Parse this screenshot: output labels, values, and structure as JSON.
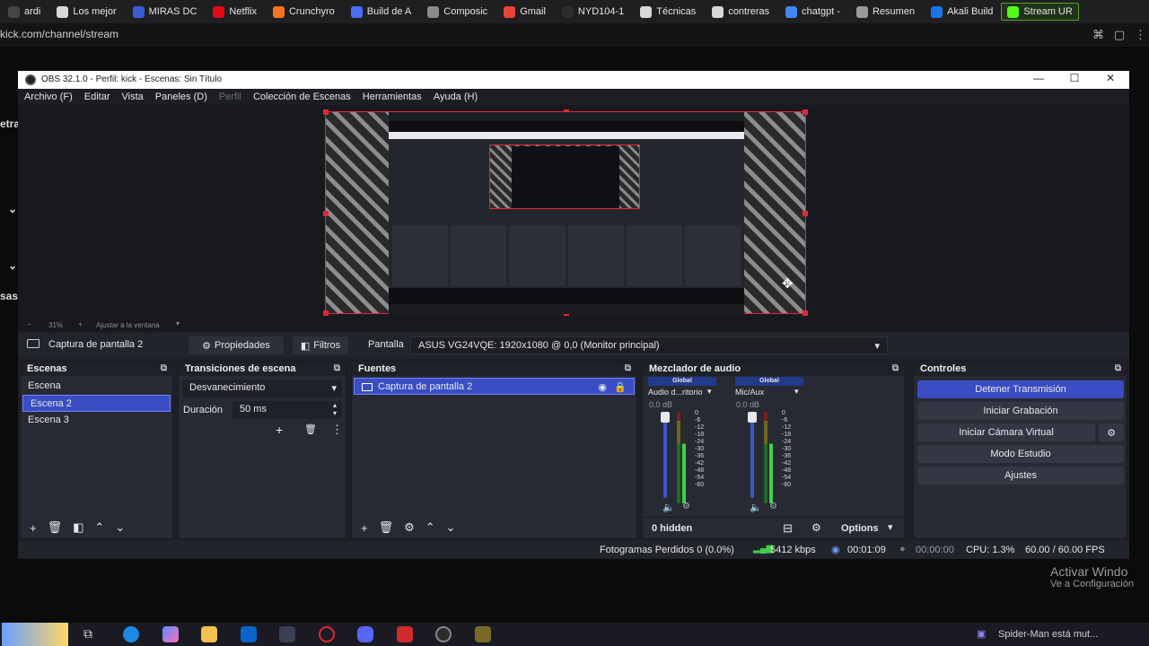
{
  "browser": {
    "bookmarks": [
      {
        "label": "ardi",
        "color": "#444444"
      },
      {
        "label": "Los mejor",
        "color": "#d8d8d8"
      },
      {
        "label": "MIRAS DC",
        "color": "#3a5bd6"
      },
      {
        "label": "Netflix",
        "color": "#e50914"
      },
      {
        "label": "Crunchyro",
        "color": "#f47521"
      },
      {
        "label": "Build de A",
        "color": "#4a6cf7"
      },
      {
        "label": "Composic",
        "color": "#8a8a8a"
      },
      {
        "label": "Gmail",
        "color": "#ea4335"
      },
      {
        "label": "NYD104-1",
        "color": "#2b2b2b"
      },
      {
        "label": "Técnicas",
        "color": "#d8d8d8"
      },
      {
        "label": "contreras",
        "color": "#d8d8d8"
      },
      {
        "label": "chatgpt -",
        "color": "#4285f4"
      },
      {
        "label": "Resumen",
        "color": "#9a9a9a"
      },
      {
        "label": "Akali Build",
        "color": "#1a73e8"
      },
      {
        "label": "Stream UR",
        "color": "#53fc18"
      }
    ],
    "url": "kick.com/channel/stream"
  },
  "page_sidebar": {
    "frag_top": "etra",
    "frag_bottom": "sas"
  },
  "obs": {
    "title": "OBS 32.1.0 - Perfil: kick - Escenas: Sin Título",
    "window_controls": {
      "minimize": "—",
      "maximize": "☐",
      "close": "✕"
    },
    "menu": [
      {
        "label": "Archivo (F)",
        "disabled": false
      },
      {
        "label": "Editar",
        "disabled": false
      },
      {
        "label": "Vista",
        "disabled": false
      },
      {
        "label": "Paneles (D)",
        "disabled": false
      },
      {
        "label": "Perfil",
        "disabled": true
      },
      {
        "label": "Colección de Escenas",
        "disabled": false
      },
      {
        "label": "Herramientas",
        "disabled": false
      },
      {
        "label": "Ayuda (H)",
        "disabled": false
      }
    ],
    "zoom": {
      "minus": "−",
      "value": "31%",
      "plus": "+",
      "fit": "Ajustar a la ventana"
    },
    "source_bar": {
      "source_name": "Captura de pantalla 2",
      "properties": "Propiedades",
      "filters": "Filtros",
      "display_label": "Pantalla",
      "display_value": "ASUS VG24VQE: 1920x1080 @ 0,0 (Monitor principal)"
    },
    "scenes": {
      "title": "Escenas",
      "items": [
        "Escena",
        "Escena 2",
        "Escena 3"
      ],
      "selected": 1
    },
    "transitions": {
      "title": "Transiciones de escena",
      "type": "Desvanecimiento",
      "duration_label": "Duración",
      "duration_value": "50 ms"
    },
    "sources": {
      "title": "Fuentes",
      "items": [
        "Captura de pantalla 2"
      ]
    },
    "mixer": {
      "title": "Mezclador de audio",
      "channels": [
        {
          "badge": "Global",
          "name": "Audio d...ritorio",
          "db": "0.0 dB",
          "level": 0.65
        },
        {
          "badge": "Global",
          "name": "Mic/Aux",
          "db": "0.0 dB",
          "level": 0.65
        }
      ],
      "ticks": [
        "0",
        "-6",
        "-12",
        "-18",
        "-24",
        "-30",
        "-36",
        "-42",
        "-48",
        "-54",
        "-60"
      ],
      "hidden": "0 hidden",
      "options": "Options"
    },
    "controls": {
      "title": "Controles",
      "stop_stream": "Detener Transmisión",
      "start_record": "Iniciar Grabación",
      "virtual_cam": "Iniciar Cámara Virtual",
      "studio_mode": "Modo Estudio",
      "settings": "Ajustes",
      "accent": "#3a4dc2"
    },
    "status": {
      "dropped": "Fotogramas Perdidos 0 (0.0%)",
      "bitrate": "5412 kbps",
      "stream_time": "00:01:09",
      "record_time": "00:00:00",
      "cpu": "CPU: 1.3%",
      "fps": "60.00 / 60.00 FPS"
    }
  },
  "windows": {
    "activate_title": "Activar Windo",
    "activate_sub": "Ve a Configuración",
    "media": "Spider-Man está mut..."
  }
}
